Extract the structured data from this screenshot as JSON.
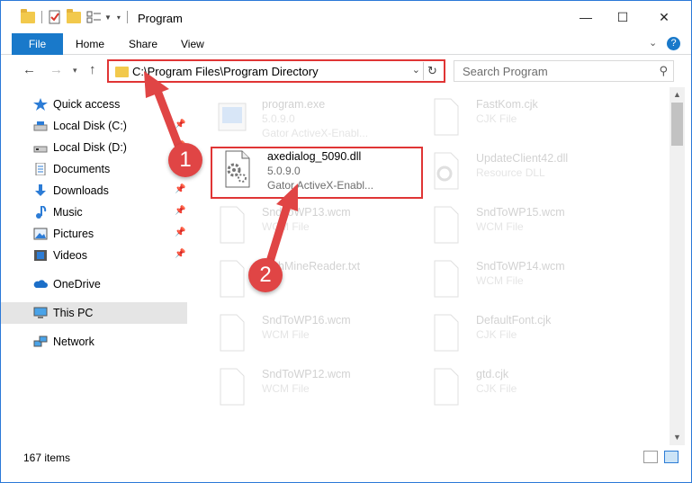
{
  "window": {
    "title": "Program",
    "controls": {
      "minimize": "—",
      "maximize": "☐",
      "close": "✕"
    }
  },
  "ribbon": {
    "file_label": "File",
    "tabs": [
      "Home",
      "Share",
      "View"
    ]
  },
  "navigation": {
    "address_path": "C:\\Program Files\\Program Directory",
    "search_placeholder": "Search Program"
  },
  "sidebar": {
    "items": [
      {
        "label": "Quick access",
        "icon": "star-icon",
        "pinned": false
      },
      {
        "label": "Local Disk (C:)",
        "icon": "drive-icon",
        "pinned": true
      },
      {
        "label": "Local Disk (D:)",
        "icon": "drive-icon",
        "pinned": true
      },
      {
        "label": "Documents",
        "icon": "documents-icon",
        "pinned": true
      },
      {
        "label": "Downloads",
        "icon": "download-icon",
        "pinned": true
      },
      {
        "label": "Music",
        "icon": "music-icon",
        "pinned": true
      },
      {
        "label": "Pictures",
        "icon": "pictures-icon",
        "pinned": true
      },
      {
        "label": "Videos",
        "icon": "videos-icon",
        "pinned": true
      },
      {
        "label": "OneDrive",
        "icon": "cloud-icon",
        "pinned": false
      },
      {
        "label": "This PC",
        "icon": "computer-icon",
        "pinned": false,
        "selected": true
      },
      {
        "label": "Network",
        "icon": "network-icon",
        "pinned": false
      }
    ]
  },
  "files": {
    "highlighted": {
      "name": "axedialog_5090.dll",
      "line1": "5.0.9.0",
      "line2": "Gator ActiveX-Enabl..."
    },
    "items": [
      {
        "name": "program.exe",
        "line1": "5.0.9.0",
        "line2": "Gator ActiveX-Enabl..."
      },
      {
        "name": "FastKom.cjk",
        "line1": "CJK File",
        "line2": ""
      },
      {
        "name": "UpdateClient42.dll",
        "line1": "Resource DLL",
        "line2": ""
      },
      {
        "name": "SndToWP13.wcm",
        "line1": "WCM File",
        "line2": ""
      },
      {
        "name": "SndToWP15.wcm",
        "line1": "WCM File",
        "line2": ""
      },
      {
        "name": "RichMineReader.txt",
        "line1": "",
        "line2": ""
      },
      {
        "name": "SndToWP14.wcm",
        "line1": "WCM File",
        "line2": ""
      },
      {
        "name": "SndToWP16.wcm",
        "line1": "WCM File",
        "line2": ""
      },
      {
        "name": "DefaultFont.cjk",
        "line1": "CJK File",
        "line2": ""
      },
      {
        "name": "SndToWP12.wcm",
        "line1": "WCM File",
        "line2": ""
      },
      {
        "name": "gtd.cjk",
        "line1": "CJK File",
        "line2": ""
      }
    ]
  },
  "status": {
    "item_count": "167 items"
  },
  "annotations": {
    "step1": "1",
    "step2": "2"
  },
  "colors": {
    "accent": "#1979ca",
    "highlight_border": "#e03535",
    "badge": "#e04545"
  }
}
